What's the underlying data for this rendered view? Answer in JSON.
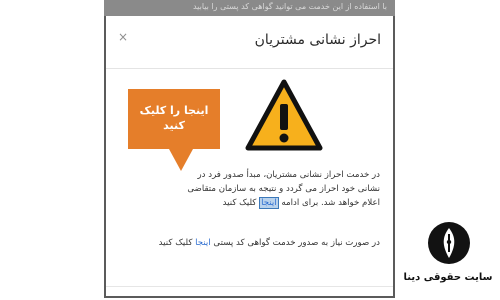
{
  "background": {
    "strip_text": "با استفاده از این خدمت می توانید گواهی کد پستی را بیابید"
  },
  "dialog": {
    "title": "احراز نشانی مشتریان",
    "close_label": "×",
    "warning_icon": "warning-triangle",
    "callout_text": "اینجا را کلیک کنید",
    "paragraph1_part1": "در خدمت احراز نشانی مشتریان، مبدأ صدور فرد در نشانی خود احراز می گردد و نتیجه به سازمان متقاضی اعلام خواهد شد. برای ادامه ",
    "paragraph1_link": "اینجا",
    "paragraph1_part2": " کلیک کنید",
    "paragraph2_part1": "در صورت نیاز به صدور خدمت گواهی کد پستی ",
    "paragraph2_link": "اینجا",
    "paragraph2_part2": " کلیک کنید"
  },
  "watermark": {
    "site_name": "سایت حقوقی دینا"
  },
  "colors": {
    "callout": "#e57e2a",
    "warning": "#f7b01c",
    "link": "#2f6fd1"
  }
}
